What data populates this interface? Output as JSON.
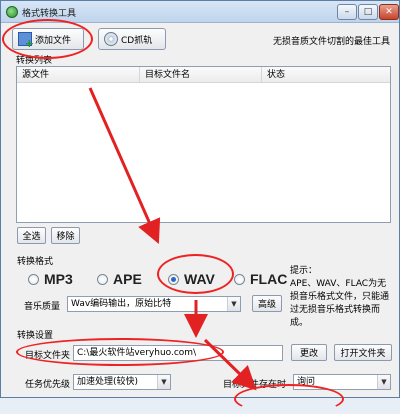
{
  "window": {
    "title": "格式转换工具",
    "min_glyph": "–",
    "max_glyph": "□",
    "close_glyph": "✕"
  },
  "toolbar": {
    "add_file_label": "添加文件",
    "cd_label": "CD抓轨",
    "tagline": "无损音质文件切割的最佳工具"
  },
  "list_section": {
    "title": "转换列表",
    "columns": [
      "源文件",
      "目标文件名",
      "状态"
    ],
    "select_all_label": "全选",
    "remove_label": "移除"
  },
  "format_section": {
    "title": "转换格式",
    "options": [
      {
        "label": "MP3",
        "checked": false
      },
      {
        "label": "APE",
        "checked": false
      },
      {
        "label": "WAV",
        "checked": true
      },
      {
        "label": "FLAC",
        "checked": false
      }
    ],
    "quality_label": "音乐质量",
    "quality_value": "Wav编码输出，原始比特",
    "advanced_label": "高级",
    "hint_text": "提示：\nAPE、WAV、FLAC为无损音乐格式文件，只能通过无损音乐格式转换而成。"
  },
  "convert_settings": {
    "title": "转换设置",
    "target_folder_label": "目标文件夹",
    "target_folder_value": "C:\\最火软件站veryhuo.com\\",
    "change_label": "更改",
    "open_folder_label": "打开文件夹",
    "priority_label": "任务优先级",
    "priority_value": "加速处理(较快)",
    "exists_label": "目标文件存在时",
    "exists_value": "询问"
  },
  "annotation_color": "#e22222"
}
